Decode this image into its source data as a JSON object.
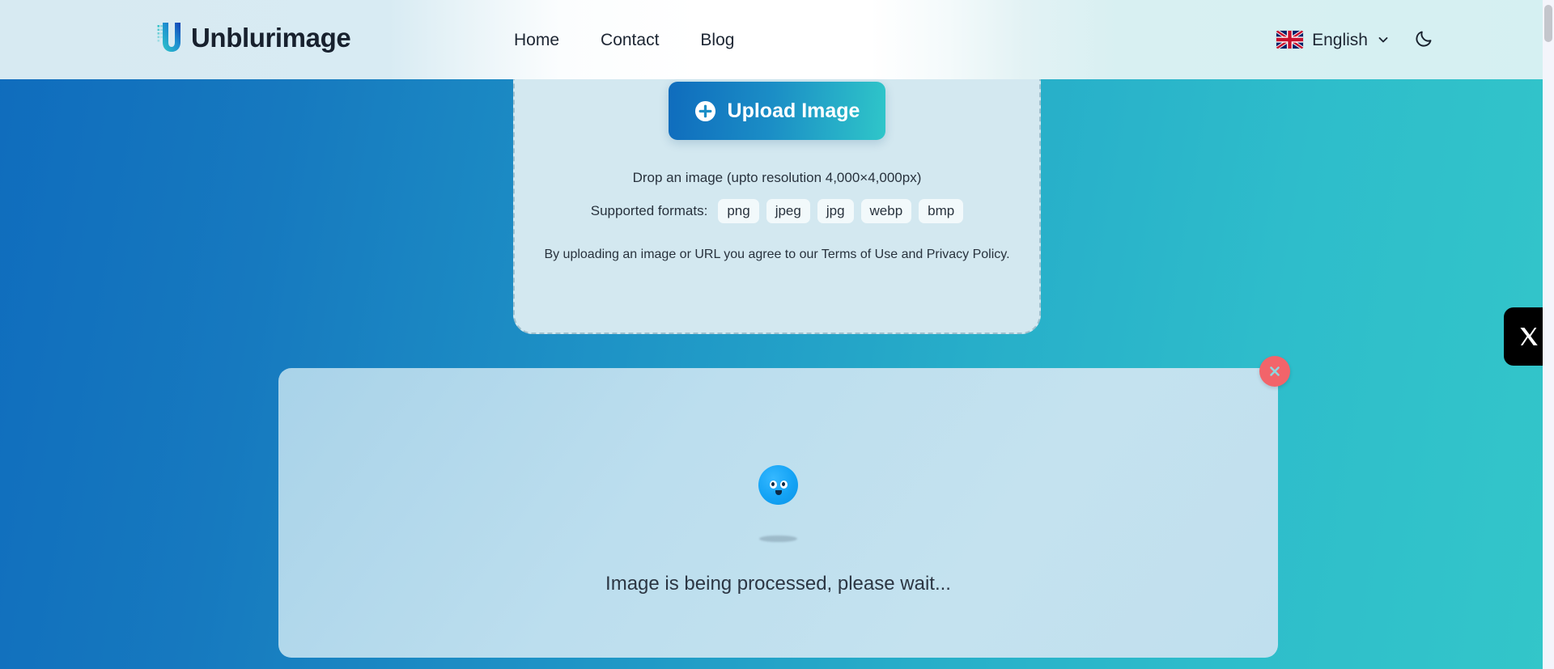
{
  "header": {
    "brand": {
      "name": "Unblurimage",
      "logo_icon": "u-logo-icon"
    },
    "nav": [
      {
        "label": "Home",
        "name": "nav-item-home"
      },
      {
        "label": "Contact",
        "name": "nav-item-contact"
      },
      {
        "label": "Blog",
        "name": "nav-item-blog"
      }
    ],
    "language": {
      "label": "English",
      "flag_icon": "uk-flag-icon",
      "chevron_icon": "chevron-down-icon"
    },
    "theme_toggle": {
      "icon": "moon-icon",
      "mode": "dark-mode-toggle"
    }
  },
  "upload": {
    "button_label": "Upload Image",
    "button_icon": "plus-circle-icon",
    "drop_hint": "Drop an image (upto resolution 4,000×4,000px)",
    "formats_label": "Supported formats:",
    "formats": [
      "png",
      "jpeg",
      "jpg",
      "webp",
      "bmp"
    ],
    "terms": "By uploading an image or URL you agree to our Terms of Use and Privacy Policy."
  },
  "result": {
    "status": "Image is being processed, please wait...",
    "close_icon": "close-x-icon",
    "loader_icon": "bouncing-ball-loader"
  },
  "social": {
    "x_label": "X",
    "x_icon": "x-twitter-icon"
  },
  "colors": {
    "bg_gradient_start": "#0f6cbd",
    "bg_gradient_end": "#33c6c9",
    "accent_blue": "#0f6cbd",
    "accent_teal": "#2fc6c9",
    "close_red": "#f2646a",
    "card_bg": "#d3e8f0",
    "panel_bg": "#bcdeee"
  }
}
